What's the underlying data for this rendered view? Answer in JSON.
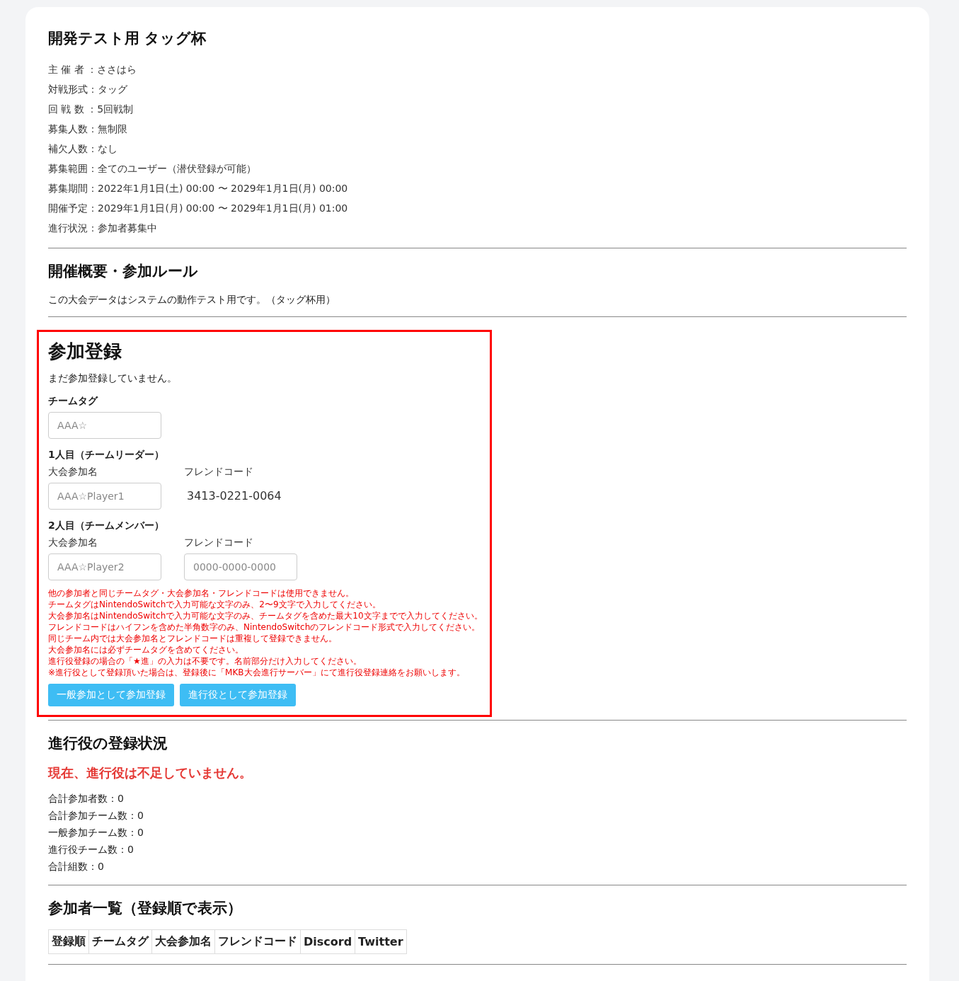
{
  "title": "開発テスト用 タッグ杯",
  "info": [
    "主 催 者 ：ささはら",
    "対戦形式：タッグ",
    "回 戦 数 ：5回戦制",
    "募集人数：無制限",
    "補欠人数：なし",
    "募集範囲：全てのユーザー（潜伏登録が可能）",
    "募集期間：2022年1月1日(土) 00:00 〜 2029年1月1日(月) 00:00",
    "開催予定：2029年1月1日(月) 00:00 〜 2029年1月1日(月) 01:00",
    "進行状況：参加者募集中"
  ],
  "overview": {
    "heading": "開催概要・参加ルール",
    "text": "この大会データはシステムの動作テスト用です。（タッグ杯用）"
  },
  "registration": {
    "heading": "参加登録",
    "status": "まだ参加登録していません。",
    "team_tag": {
      "label": "チームタグ",
      "placeholder": "AAA☆"
    },
    "players": [
      {
        "heading": "1人目（チームリーダー）",
        "name_label": "大会参加名",
        "name_placeholder": "AAA☆Player1",
        "code_label": "フレンドコード",
        "code": {
          "kind": "fixed",
          "text": "3413-0221-0064"
        }
      },
      {
        "heading": "2人目（チームメンバー）",
        "name_label": "大会参加名",
        "name_placeholder": "AAA☆Player2",
        "code_label": "フレンドコード",
        "code": {
          "kind": "input",
          "placeholder": "0000-0000-0000"
        }
      }
    ],
    "notes": [
      "他の参加者と同じチームタグ・大会参加名・フレンドコードは使用できません。",
      "チームタグはNintendoSwitchで入力可能な文字のみ、2〜9文字で入力してください。",
      "大会参加名はNintendoSwitchで入力可能な文字のみ、チームタグを含めた最大10文字までで入力してください。",
      "フレンドコードはハイフンを含めた半角数字のみ、NintendoSwitchのフレンドコード形式で入力してください。",
      "同じチーム内では大会参加名とフレンドコードは重複して登録できません。",
      "大会参加名には必ずチームタグを含めてください。",
      "進行役登録の場合の「★進」の入力は不要です。名前部分だけ入力してください。",
      "※進行役として登録頂いた場合は、登録後に「MKB大会進行サーバー」にて進行役登録連絡をお願いします。"
    ],
    "buttons": [
      "一般参加として参加登録",
      "進行役として参加登録"
    ]
  },
  "organizer_status": {
    "heading": "進行役の登録状況",
    "alert": "現在、進行役は不足していません。",
    "stats": [
      "合計参加者数：0",
      "合計参加チーム数：0",
      "一般参加チーム数：0",
      "進行役チーム数：0",
      "合計組数：0"
    ]
  },
  "participants": {
    "heading": "参加者一覧（登録順で表示）",
    "columns": [
      "登録順",
      "チームタグ",
      "大会参加名",
      "フレンドコード",
      "Discord",
      "Twitter"
    ]
  }
}
